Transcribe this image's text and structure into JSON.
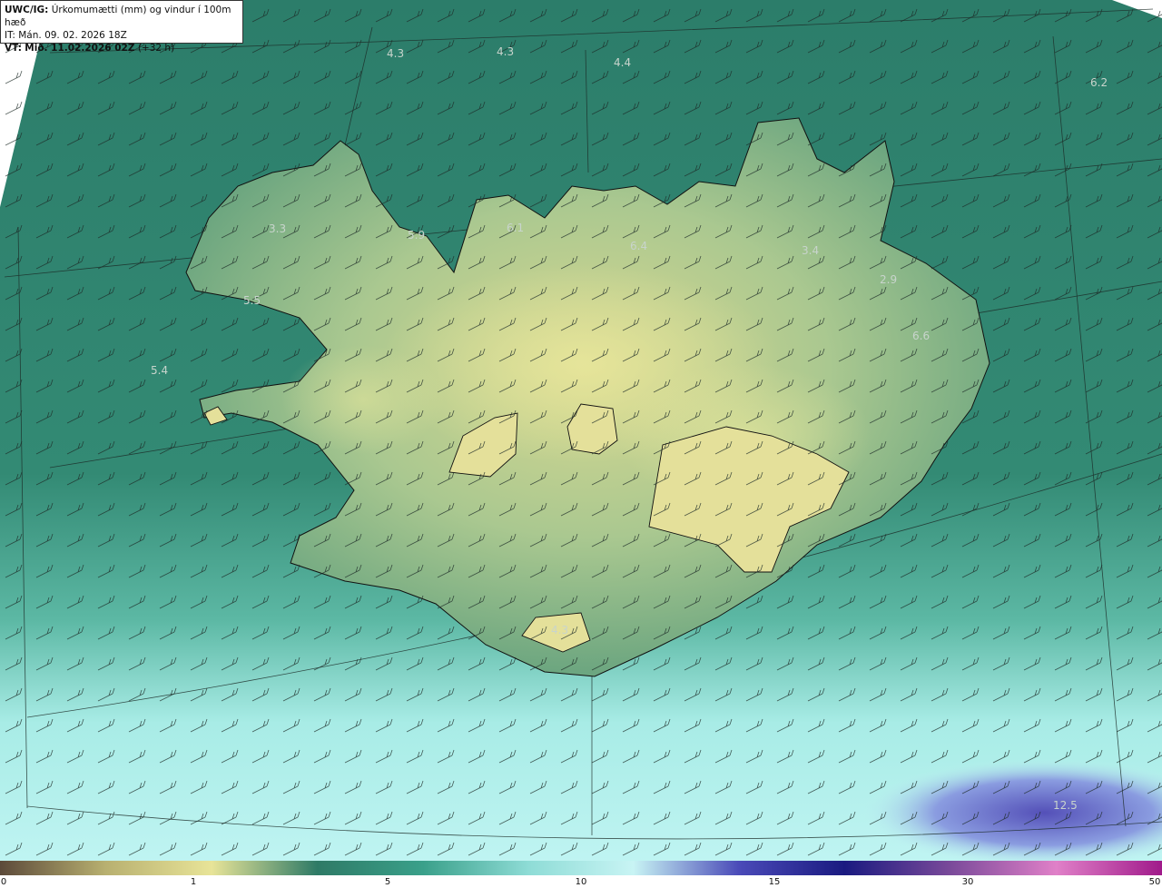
{
  "header": {
    "model": "UWC/IG:",
    "description": "Úrkomumætti (mm) og vindur í 100m hæð",
    "it_label": "IT:",
    "it_value": "Mán. 09. 02. 2026 18Z",
    "vt_label": "VT:",
    "vt_value": "Mið. 11.02.2026 02Z",
    "lead": "(+32 h)"
  },
  "map_values": [
    "4.3",
    "4.3",
    "4.4",
    "6.2",
    "3.3",
    "5.9",
    "6.1",
    "6.4",
    "3.4",
    "2.9",
    "5.5",
    "5.4",
    "6.6",
    "4.3",
    "12.5"
  ],
  "legend": {
    "ticks": [
      "0",
      "1",
      "5",
      "10",
      "15",
      "30",
      "50"
    ],
    "colors": [
      "#5c4a3a",
      "#b8b070",
      "#e8e498",
      "#2e7a66",
      "#3aa08a",
      "#8edcd6",
      "#c8f4f4",
      "#4a4ab8",
      "#1a1a80",
      "#7a4a9a",
      "#e080c8",
      "#a01a8a"
    ]
  },
  "colors": {
    "sea_deep": "#2e7a66",
    "land_low": "#6aa87a",
    "land_high": "#e6e29a",
    "precip_light": "#9ee8e2",
    "precip_heavy": "#5a58b8"
  }
}
